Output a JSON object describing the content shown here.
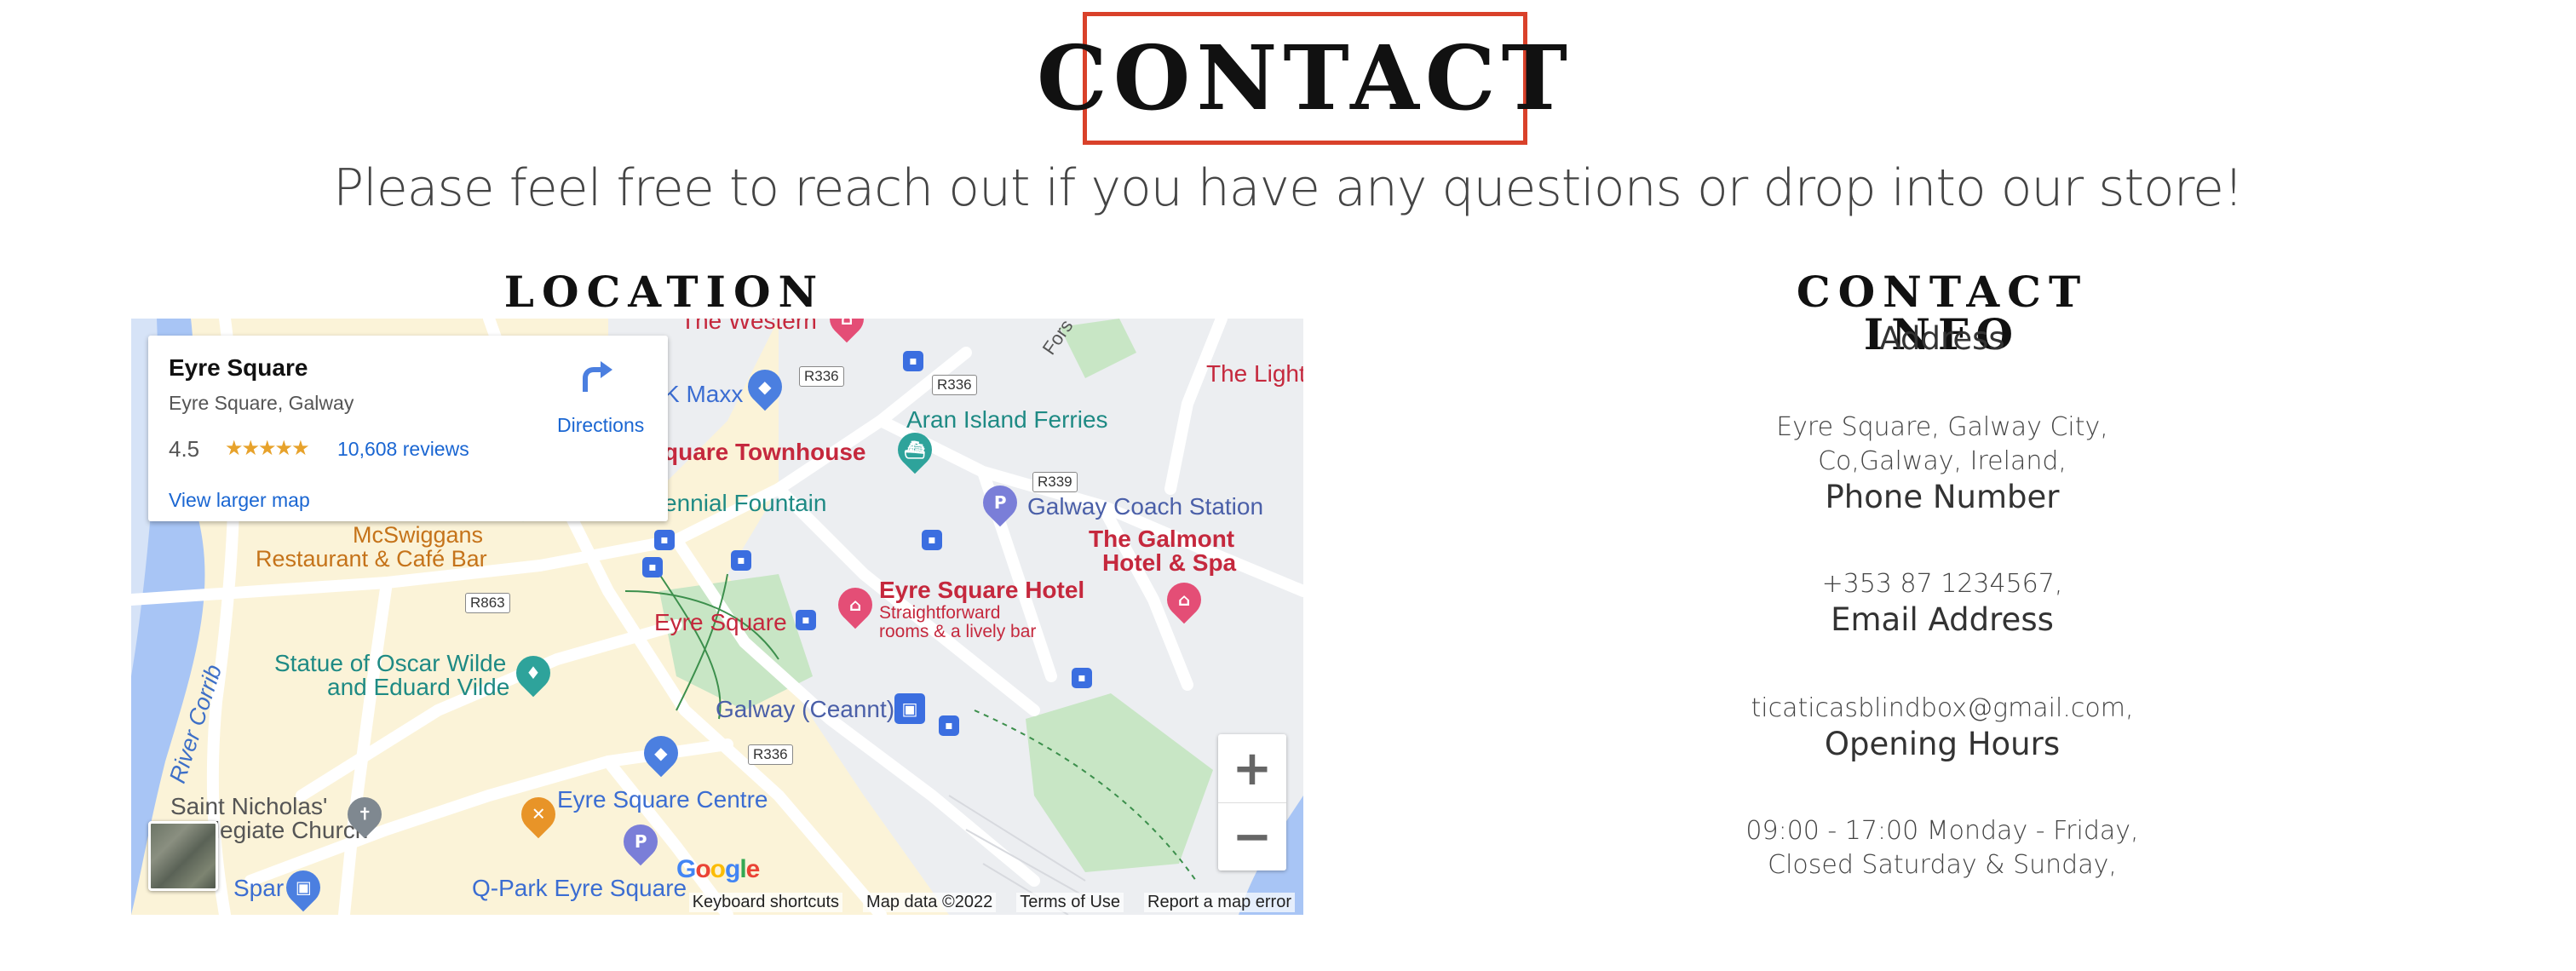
{
  "header": {
    "title": "CONTACT",
    "subtitle": "Please feel free to reach out if you have any questions or drop into our store!"
  },
  "location": {
    "heading": "LOCATION",
    "map": {
      "card": {
        "place_name": "Eyre Square",
        "address": "Eyre Square, Galway",
        "rating": "4.5",
        "stars": "★★★★★",
        "reviews": "10,608 reviews",
        "directions": "Directions",
        "view_larger": "View larger map"
      },
      "labels": {
        "the_western": "The Western",
        "tk_maxx": "K Maxx",
        "square_townhouse": "quare Townhouse",
        "centennial_fountain": "ennial Fountain",
        "aran_island_ferries": "Aran Island Ferries",
        "the_light": "The Light",
        "galway_coach_station": "Galway Coach Station",
        "the_galmont": "The Galmont",
        "hotel_spa": "Hotel & Spa",
        "mcswiggans": "McSwiggans",
        "restaurant_cafe_bar": "Restaurant & Café Bar",
        "eyre_square_hotel": "Eyre Square Hotel",
        "eyre_square_hotel_desc1": "Straightforward",
        "eyre_square_hotel_desc2": "rooms & a lively bar",
        "eyre_square": "Eyre Square",
        "statue_line1": "Statue of Oscar Wilde",
        "statue_line2": "and Eduard Vilde",
        "galway_ceannt": "Galway (Ceannt)",
        "river_corrib": "River Corrib",
        "saint_nicholas_line1": "Saint Nicholas'",
        "saint_nicholas_line2": "ollegiate Church",
        "eyre_square_centre": "Eyre Square Centre",
        "spar": "Spar",
        "qpark": "Q-Park Eyre Square",
        "forster": "Fors"
      },
      "road_tags": {
        "r336_a": "R336",
        "r336_b": "R336",
        "r339": "R339",
        "r863": "R863",
        "r336_c": "R336"
      },
      "zoom_in": "+",
      "zoom_out": "−",
      "google": "Google",
      "footer": {
        "keyboard": "Keyboard shortcuts",
        "map_data": "Map data ©2022",
        "terms": "Terms of Use",
        "report": "Report a map error"
      }
    }
  },
  "contact_info": {
    "heading": "CONTACT INFO",
    "address_label": "Address",
    "address_line1": "Eyre Square, Galway City,",
    "address_line2": "Co,Galway, Ireland,",
    "phone_label": "Phone Number",
    "phone": "+353 87 1234567,",
    "email_label": "Email Address",
    "email": "ticaticasblindbox@gmail.com,",
    "hours_label": "Opening Hours",
    "hours_line1": "09:00 - 17:00 Monday - Friday,",
    "hours_line2": "Closed Saturday & Sunday,"
  },
  "colors": {
    "title_border": "#d9412a",
    "link_blue": "#1a66d2",
    "star": "#e7a22b",
    "map_land": "#fbf3d8",
    "water": "#a8c5f5",
    "park": "#c8e6c5"
  }
}
